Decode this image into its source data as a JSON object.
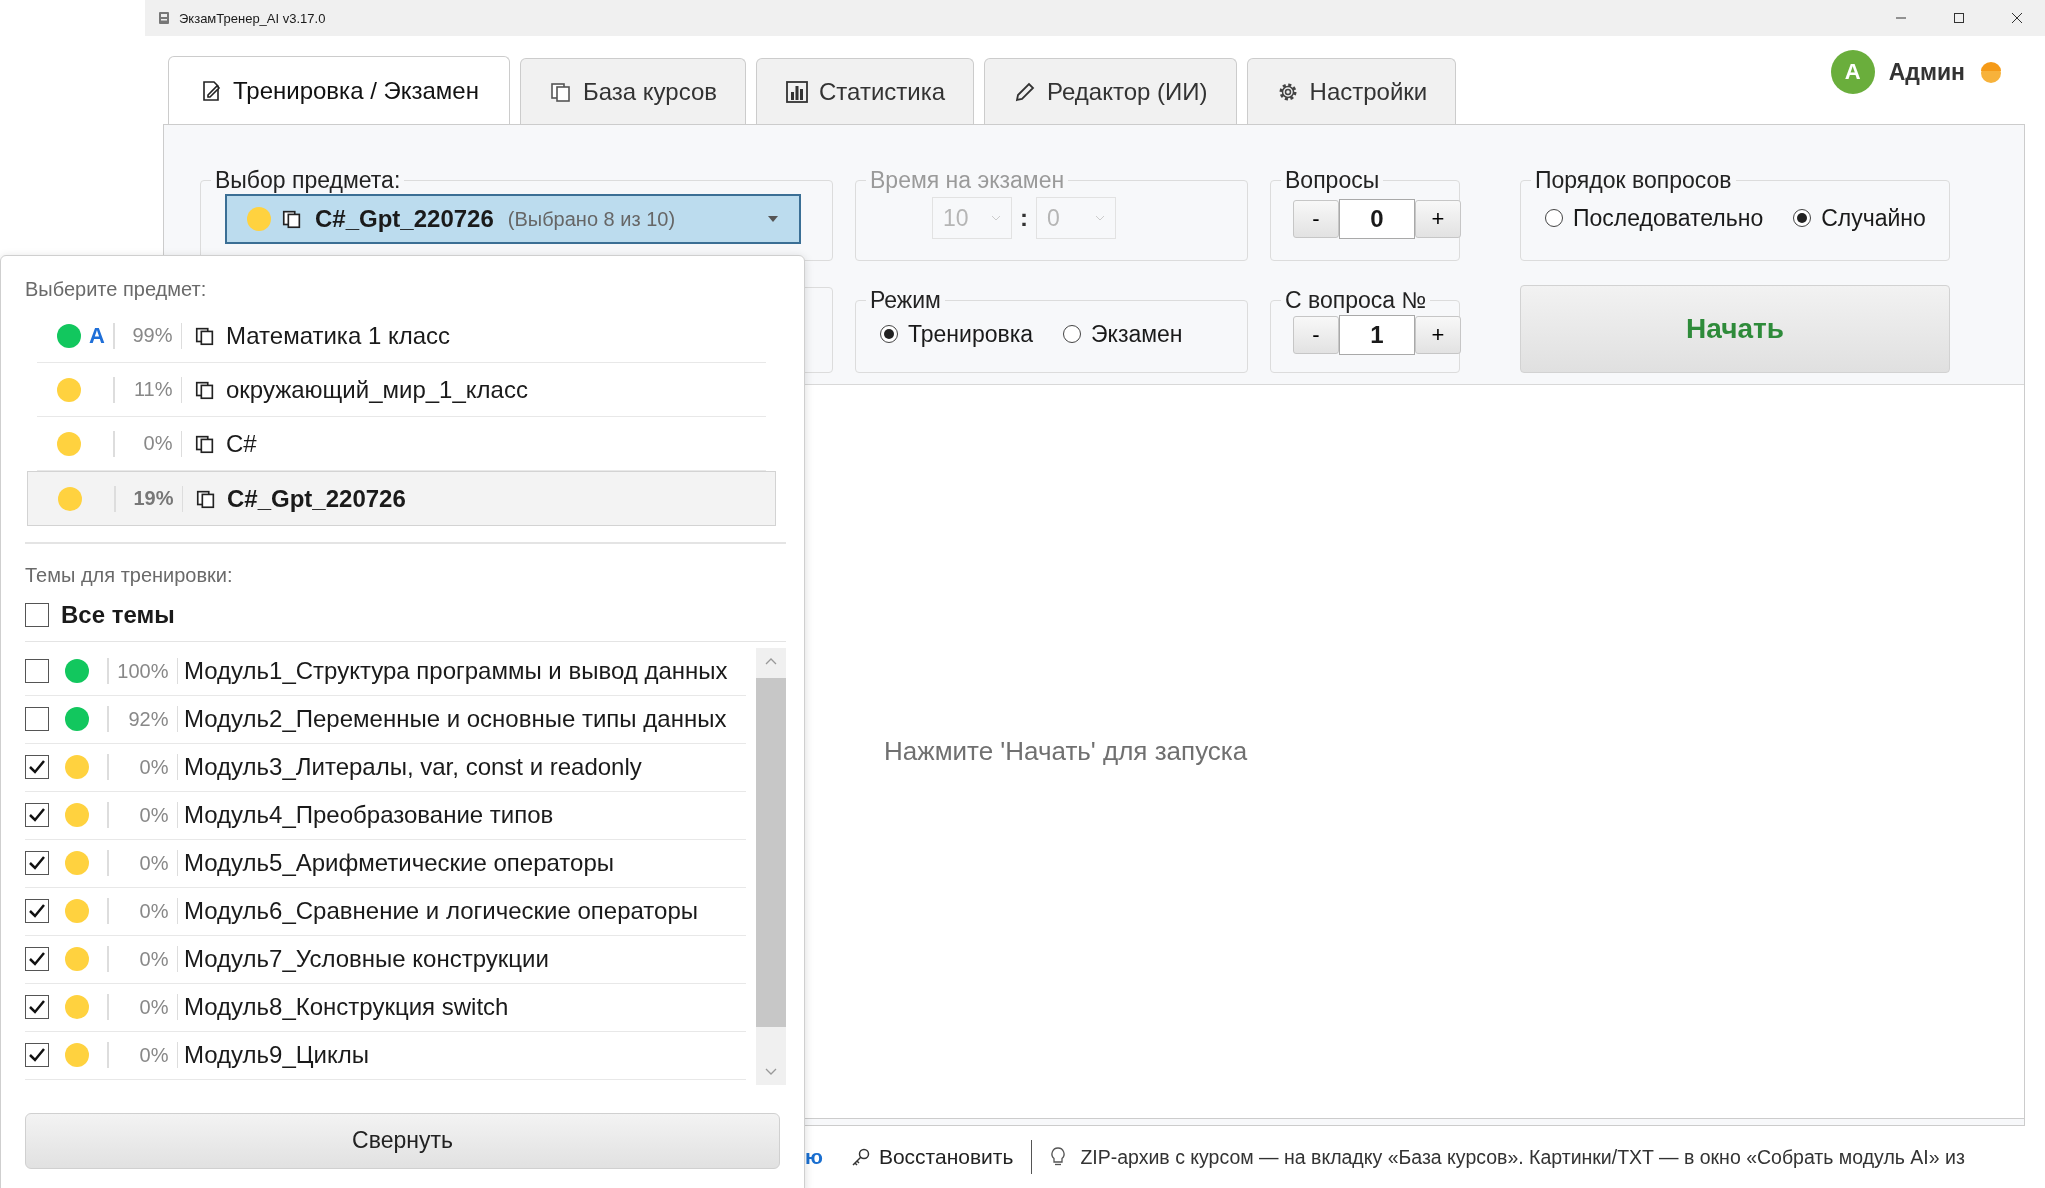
{
  "window": {
    "title": "ЭкзамТренер_AI v3.17.0"
  },
  "tabs": [
    {
      "label": "Тренировка / Экзамен",
      "selected": true
    },
    {
      "label": "База курсов",
      "selected": false
    },
    {
      "label": "Статистика",
      "selected": false
    },
    {
      "label": "Редактор (ИИ)",
      "selected": false
    },
    {
      "label": "Настройки",
      "selected": false
    }
  ],
  "user": {
    "initial": "А",
    "name": "Админ"
  },
  "subject_group": {
    "label": "Выбор предмета:",
    "combo": {
      "color": "#ffd23f",
      "name": "C#_Gpt_220726",
      "note": "(Выбрано 8 из 10)"
    }
  },
  "exam_time": {
    "label": "Время на экзамен",
    "disabled": true,
    "minutes": "10",
    "separator": ":",
    "seconds": "0"
  },
  "questions": {
    "label": "Вопросы",
    "minus": "-",
    "value": "0",
    "plus": "+"
  },
  "order": {
    "label": "Порядок вопросов",
    "options": [
      {
        "label": "Последовательно",
        "selected": false
      },
      {
        "label": "Случайно",
        "selected": true
      }
    ]
  },
  "mode": {
    "label": "Режим",
    "options": [
      {
        "label": "Тренировка",
        "selected": true
      },
      {
        "label": "Экзамен",
        "selected": false
      }
    ]
  },
  "start_from": {
    "label": "С вопроса №",
    "minus": "-",
    "value": "1",
    "plus": "+"
  },
  "start_button": "Начать",
  "hint": "Нажмите 'Начать' для запуска",
  "status_bar": {
    "link_fragment": "ю",
    "restore": "Восстановить",
    "tip": "ZIP-архив с курсом — на вкладку «База курсов». Картинки/TXT — в окно «Собрать модуль AI» из"
  },
  "dropdown": {
    "subjects_label": "Выберите предмет:",
    "subjects": [
      {
        "color": "#12c75e",
        "badge": "A",
        "percent": "99%",
        "name": "Математика 1 класс",
        "selected": false
      },
      {
        "color": "#ffd23f",
        "percent": "11%",
        "name": "окружающий_мир_1_класс",
        "selected": false
      },
      {
        "color": "#ffd23f",
        "percent": "0%",
        "name": "C#",
        "selected": false
      },
      {
        "color": "#ffd23f",
        "percent": "19%",
        "name": "C#_Gpt_220726",
        "selected": true
      }
    ],
    "topics_label": "Темы для тренировки:",
    "all_topics": {
      "label": "Все темы",
      "checked": false
    },
    "topics": [
      {
        "checked": false,
        "color": "#12c75e",
        "percent": "100%",
        "name": "Модуль1_Структура программы и вывод данных"
      },
      {
        "checked": false,
        "color": "#12c75e",
        "percent": "92%",
        "name": "Модуль2_Переменные и основные типы данных"
      },
      {
        "checked": true,
        "color": "#ffd23f",
        "percent": "0%",
        "name": "Модуль3_Литералы, var, const и readonly"
      },
      {
        "checked": true,
        "color": "#ffd23f",
        "percent": "0%",
        "name": "Модуль4_Преобразование типов"
      },
      {
        "checked": true,
        "color": "#ffd23f",
        "percent": "0%",
        "name": "Модуль5_Арифметические операторы"
      },
      {
        "checked": true,
        "color": "#ffd23f",
        "percent": "0%",
        "name": "Модуль6_Сравнение и логические операторы"
      },
      {
        "checked": true,
        "color": "#ffd23f",
        "percent": "0%",
        "name": "Модуль7_Условные конструкции"
      },
      {
        "checked": true,
        "color": "#ffd23f",
        "percent": "0%",
        "name": "Модуль8_Конструкция switch"
      },
      {
        "checked": true,
        "color": "#ffd23f",
        "percent": "0%",
        "name": "Модуль9_Циклы"
      }
    ],
    "collapse_button": "Свернуть"
  }
}
